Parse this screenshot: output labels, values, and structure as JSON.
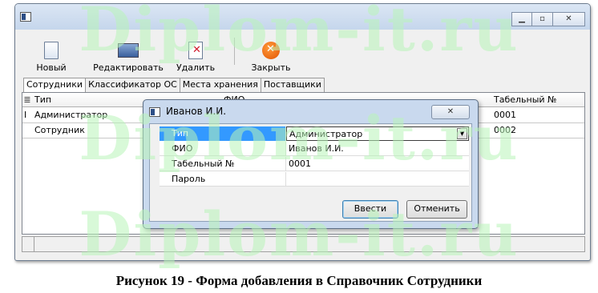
{
  "window": {
    "controls": [
      "▁",
      "▫",
      "✕"
    ]
  },
  "toolbar": {
    "new_label": "Новый",
    "edit_label": "Редактировать",
    "delete_label": "Удалить",
    "close_label": "Закрыть"
  },
  "tabs": [
    {
      "label": "Сотрудники",
      "active": true
    },
    {
      "label": "Классификатор ОС",
      "active": false
    },
    {
      "label": "Места хранения",
      "active": false
    },
    {
      "label": "Поставщики",
      "active": false
    }
  ],
  "grid": {
    "columns": [
      "Тип",
      "ФИО",
      "Табельный №"
    ],
    "rows": [
      {
        "indicator": "I",
        "type": "Администратор",
        "fio": "",
        "tab_no": "0001"
      },
      {
        "indicator": "",
        "type": "Сотрудник",
        "fio": "",
        "tab_no": "0002"
      }
    ],
    "header_icon": "list-icon"
  },
  "dialog": {
    "title": "Иванов И.И.",
    "close_glyph": "✕",
    "properties": [
      {
        "key": "Тип",
        "value": "Администратор",
        "selected": true
      },
      {
        "key": "ФИО",
        "value": "Иванов И.И."
      },
      {
        "key": "Табельный №",
        "value": "0001"
      },
      {
        "key": "Пароль",
        "value": ""
      }
    ],
    "ok_label": "Ввести",
    "cancel_label": "Отменить"
  },
  "watermark": "Diplom-it.ru",
  "caption": "Рисунок 19 - Форма добавления в Справочник Сотрудники",
  "colors": {
    "selection": "#3399ff",
    "watermark": "#b9f5b9",
    "titlebar": "#c5d6ec"
  }
}
